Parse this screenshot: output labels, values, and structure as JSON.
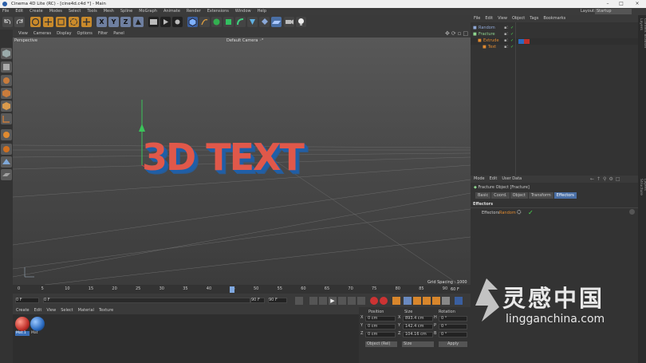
{
  "window": {
    "title": "Cinema 4D Lite (RC) - [cine4d.c4d *] - Main",
    "minimize": "–",
    "maximize": "□",
    "close": "×"
  },
  "menu": [
    "File",
    "Edit",
    "Create",
    "Modes",
    "Select",
    "Tools",
    "Mesh",
    "Spline",
    "MoGraph",
    "Animate",
    "Render",
    "Extensions",
    "Window",
    "Help"
  ],
  "layout": {
    "label": "Layout:",
    "value": "Startup"
  },
  "toolbar": {
    "x": "X",
    "y": "Y",
    "z": "Z"
  },
  "viewport": {
    "menu": [
      "View",
      "Cameras",
      "Display",
      "Options",
      "Filter",
      "Panel"
    ],
    "label": "Perspective",
    "camera": "Default Camera ◦°",
    "grid_spacing": "Grid Spacing : 1000 cm",
    "text": "3D TEXT"
  },
  "timeline": {
    "ticks": [
      "0",
      "5",
      "10",
      "15",
      "20",
      "25",
      "30",
      "35",
      "40",
      "45",
      "50",
      "55",
      "60",
      "65",
      "70",
      "75",
      "80",
      "85",
      "90"
    ],
    "current_frame": "60 F",
    "start": "0 F",
    "from": "0 F",
    "to": "90 F",
    "end": "90 F"
  },
  "materials": {
    "menu": [
      "Create",
      "Edit",
      "View",
      "Select",
      "Material",
      "Texture"
    ],
    "items": [
      "Mat.1",
      "Mat"
    ]
  },
  "coords": {
    "headers": [
      "Position",
      "Size",
      "Rotation"
    ],
    "rows": [
      {
        "axis": "X",
        "pos": "0 cm",
        "saxis": "X",
        "size": "893.4 cm",
        "raxis": "H",
        "rot": "0 °"
      },
      {
        "axis": "Y",
        "pos": "0 cm",
        "saxis": "Y",
        "size": "142.4 cm",
        "raxis": "P",
        "rot": "0 °"
      },
      {
        "axis": "Z",
        "pos": "0 cm",
        "saxis": "Z",
        "size": "104.16 cm",
        "raxis": "B",
        "rot": "0 °"
      }
    ],
    "mode1": "Object (Rel)",
    "mode2": "Size",
    "apply": "Apply"
  },
  "objects": {
    "menu": [
      "File",
      "Edit",
      "View",
      "Object",
      "Tags",
      "Bookmarks"
    ],
    "items": [
      {
        "name": "Random",
        "indent": 0,
        "color": "#8fa8d6"
      },
      {
        "name": "Fracture",
        "indent": 0,
        "color": "#8fd68f"
      },
      {
        "name": "Extrude",
        "indent": 1,
        "color": "#e08a30"
      },
      {
        "name": "Text",
        "indent": 2,
        "color": "#e08a30"
      }
    ]
  },
  "attributes": {
    "menu": [
      "Mode",
      "Edit",
      "User Data"
    ],
    "title": "Fracture Object [Fracture]",
    "tabs": [
      "Basic",
      "Coord.",
      "Object",
      "Transform",
      "Effectors"
    ],
    "active_tab": "Effectors",
    "section": "Effectors",
    "field_label": "Effectors",
    "field_value": "Random"
  },
  "side_tabs": [
    "Objects",
    "Takes",
    "Content Browser",
    "Layers"
  ],
  "side_tabs2": [
    "Attributes",
    "Layers",
    "Structure"
  ],
  "watermark": {
    "cn": "灵感中国",
    "url": "lingganchina.com"
  }
}
